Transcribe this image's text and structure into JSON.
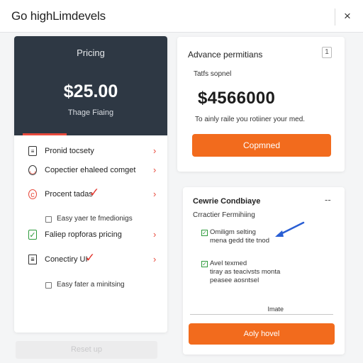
{
  "window": {
    "title": "Go highLimdevels",
    "close_glyph": "×"
  },
  "pricing": {
    "label": "Pricing",
    "amount": "$25.00",
    "sub": "Thage Fiaing"
  },
  "features": [
    {
      "label": "Pronid tocsety",
      "icon": "document-icon"
    },
    {
      "label": "Copectier ehaleed comget",
      "icon": "face-icon"
    },
    {
      "label": "Procent tadas",
      "icon": "swirl-icon"
    },
    {
      "label": "Faliep ropforas pricing",
      "icon": "green-check-icon"
    },
    {
      "label": "Conectiry UI",
      "icon": "file-icon"
    }
  ],
  "feature_chevron": "›",
  "sub_options": [
    {
      "label": "Easy yaer te fmedionigs"
    },
    {
      "label": "Easy fater a minitsing"
    }
  ],
  "reset_button": "Reset up",
  "card1": {
    "title": "Advance permitians",
    "badge": "1",
    "sub": "Tatfs sopnel",
    "amount": "$4566000",
    "desc": "To ainly raile you rotiiner your med.",
    "button": "Copmned"
  },
  "card2": {
    "title": "Cewrie Condbiaye",
    "collapse_glyph": "--",
    "sub": "Crractier Fermihiing",
    "option1": {
      "line1": "Omiligm selting",
      "line2": "mena gedd tite tnod"
    },
    "option2": {
      "line1": "Avel texmed",
      "line2": "tiray as teacivsts monta",
      "line3": "peasee aosntsel"
    },
    "input_value": "Imate",
    "button": "Aoly hovel"
  },
  "colors": {
    "accent_orange": "#f26b1d",
    "dark_card": "#2e3844",
    "red": "#e84a3c",
    "green": "#2c9a3a",
    "blue_arrow": "#2a5fd4"
  }
}
